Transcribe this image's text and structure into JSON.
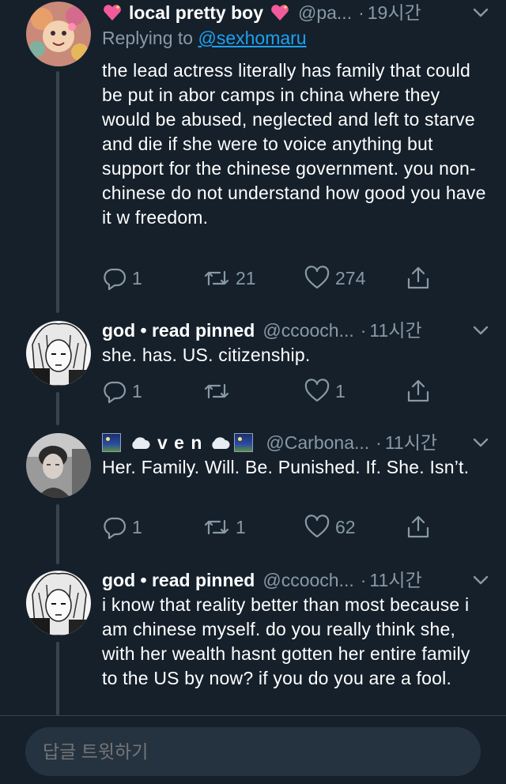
{
  "tweets": [
    {
      "display_name": "local pretty boy",
      "name_emoji": "sparkling-heart",
      "handle": "@pa...",
      "time": "19시간",
      "replying_prefix": "Replying to",
      "replying_to": "@sexhomaru",
      "text": "the lead actress literally has family that could be put in abor camps in china where they would be abused, neglected and left to starve and die if she were to voice anything but support for the chinese government. you non-chinese do not understand how good you have it w freedom.",
      "replies": "1",
      "retweets": "21",
      "likes": "274"
    },
    {
      "display_name": "god • read pinned",
      "handle": "@ccooch...",
      "time": "11시간",
      "text": "she. has. US. citizenship.",
      "replies": "1",
      "retweets": "",
      "likes": "1"
    },
    {
      "display_name": "v e n",
      "name_emoji": "night-city-cloud",
      "handle": "@Carbona...",
      "time": "11시간",
      "text": "Her. Family. Will. Be. Punished. If. She. Isn’t.",
      "replies": "1",
      "retweets": "1",
      "likes": "62"
    },
    {
      "display_name": "god • read pinned",
      "handle": "@ccooch...",
      "time": "11시간",
      "text": "i know that reality better than most because i am chinese myself. do you really think she, with her wealth hasnt gotten her entire family to the US by now? if you do you are a fool."
    }
  ],
  "separator": "·",
  "composer": {
    "placeholder": "답글 트윗하기"
  },
  "colors": {
    "background": "#15202b",
    "secondary_text": "#8899a6",
    "link": "#1da1f2",
    "thread_line": "#38444d",
    "composer_bg": "#253341"
  },
  "icons": [
    "reply-icon",
    "retweet-icon",
    "like-icon",
    "share-icon",
    "caret-down-icon"
  ]
}
